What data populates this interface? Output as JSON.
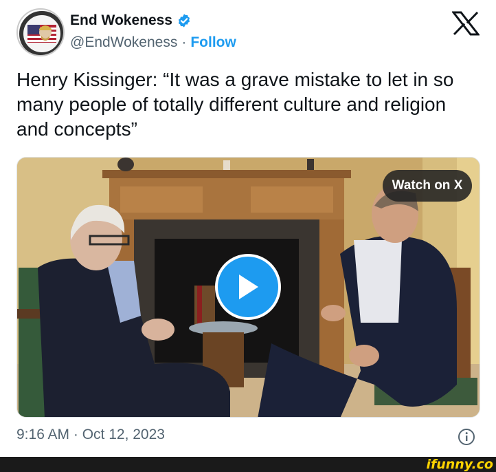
{
  "author": {
    "display_name": "End Wokeness",
    "handle": "@EndWokeness",
    "separator": "·",
    "follow_label": "Follow",
    "avatar_icon": "support-badge-icon",
    "verified_color": "#1d9bf0"
  },
  "tweet": {
    "text": "Henry Kissinger: “It was a grave mistake to let in so many people of totally different culture and religion and concepts”"
  },
  "media": {
    "watch_label": "Watch on X",
    "play_icon": "play-icon"
  },
  "meta": {
    "timestamp": "9:16 AM · Oct 12, 2023",
    "info_icon": "info-icon"
  },
  "watermark": {
    "text": "ifunny.co"
  },
  "colors": {
    "accent": "#1d9bf0",
    "text_primary": "#0f1419",
    "text_secondary": "#536471",
    "watermark": "#ffd400"
  }
}
